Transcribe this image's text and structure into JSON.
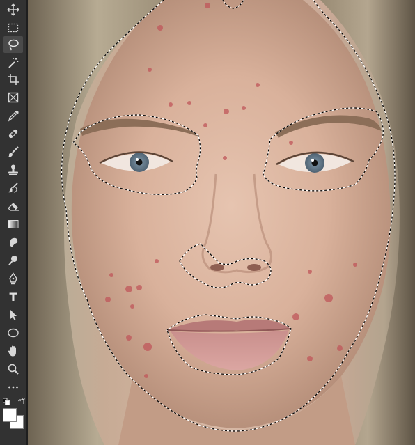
{
  "toolbar": {
    "tools": [
      {
        "name": "move-tool",
        "icon": "move-icon"
      },
      {
        "name": "rectangular-marquee-tool",
        "icon": "marquee-icon"
      },
      {
        "name": "lasso-tool",
        "icon": "lasso-icon",
        "active": true
      },
      {
        "name": "magic-wand-tool",
        "icon": "magic-wand-icon"
      },
      {
        "name": "crop-tool",
        "icon": "crop-icon"
      },
      {
        "name": "frame-tool",
        "icon": "frame-icon"
      },
      {
        "name": "eyedropper-tool",
        "icon": "eyedropper-icon"
      },
      {
        "name": "healing-brush-tool",
        "icon": "bandage-icon"
      },
      {
        "name": "brush-tool",
        "icon": "brush-icon"
      },
      {
        "name": "clone-stamp-tool",
        "icon": "stamp-icon"
      },
      {
        "name": "history-brush-tool",
        "icon": "history-brush-icon"
      },
      {
        "name": "eraser-tool",
        "icon": "eraser-icon"
      },
      {
        "name": "gradient-tool",
        "icon": "gradient-icon"
      },
      {
        "name": "smudge-tool",
        "icon": "smudge-icon"
      },
      {
        "name": "dodge-tool",
        "icon": "dodge-icon"
      },
      {
        "name": "pen-tool",
        "icon": "pen-icon"
      },
      {
        "name": "type-tool",
        "icon": "type-icon",
        "label": "T"
      },
      {
        "name": "path-selection-tool",
        "icon": "arrow-icon"
      },
      {
        "name": "ellipse-tool",
        "icon": "ellipse-icon"
      },
      {
        "name": "hand-tool",
        "icon": "hand-icon"
      },
      {
        "name": "zoom-tool",
        "icon": "zoom-icon"
      },
      {
        "name": "edit-toolbar",
        "icon": "more-icon"
      }
    ],
    "foreground_color": "#ffffff",
    "background_color": "#ffffff",
    "panel_color": "#323232"
  },
  "canvas": {
    "content": "portrait-photo",
    "selection": "lasso-marching-ants"
  }
}
